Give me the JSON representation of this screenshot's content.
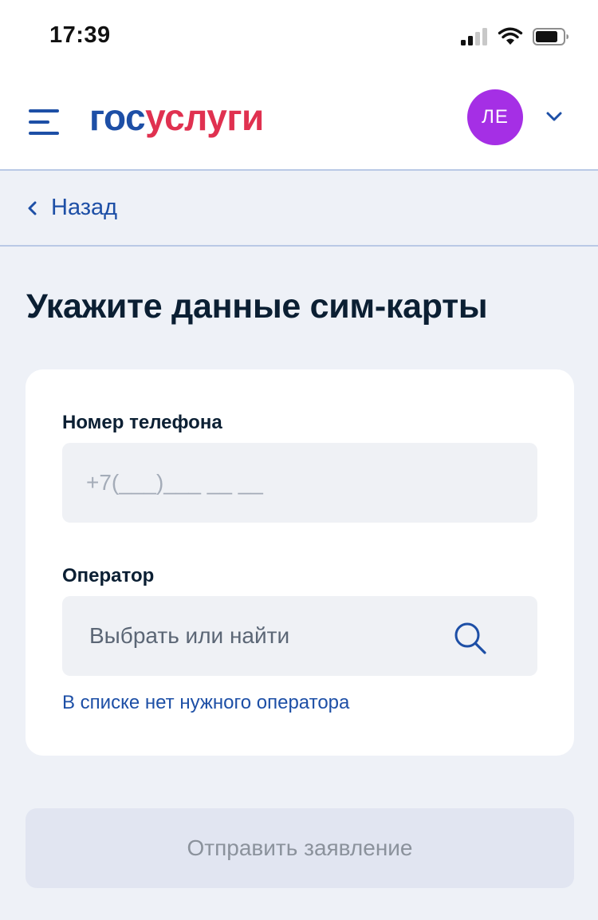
{
  "status_bar": {
    "time": "17:39",
    "icons": [
      "cellular-signal-icon",
      "wifi-icon",
      "battery-icon"
    ]
  },
  "header": {
    "logo_part1": "гос",
    "logo_part2": "услуги",
    "avatar_initials": "ЛЕ",
    "colors": {
      "logo_blue": "#1d4fa6",
      "logo_red": "#e03150",
      "avatar": "#a52fe5"
    }
  },
  "nav": {
    "back_label": "Назад"
  },
  "page": {
    "title": "Укажите данные сим-карты"
  },
  "form": {
    "phone": {
      "label": "Номер телефона",
      "placeholder": "+7(___)___ __ __",
      "value": ""
    },
    "operator": {
      "label": "Оператор",
      "placeholder": "Выбрать или найти",
      "value": ""
    },
    "missing_operator_link": "В списке нет нужного оператора"
  },
  "actions": {
    "submit_label": "Отправить заявление",
    "submit_disabled": true
  }
}
